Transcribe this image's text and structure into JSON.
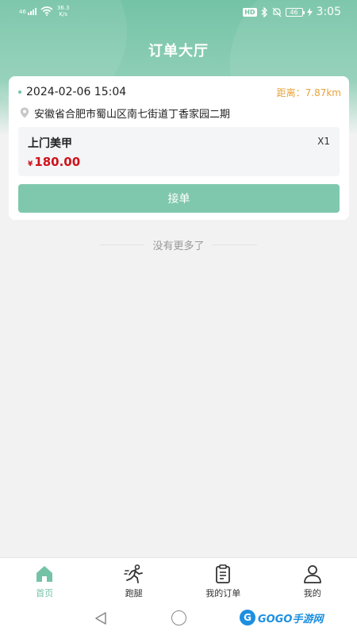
{
  "status_bar": {
    "network_label": "46",
    "speed_value": "36.3",
    "speed_unit": "K/s",
    "hd_label": "HD",
    "battery_label": "46",
    "time": "3:05"
  },
  "header": {
    "title": "订单大厅"
  },
  "order": {
    "datetime": "2024-02-06 15:04",
    "distance": "距离：7.87km",
    "address": "安徽省合肥市蜀山区南七街道丁香家园二期",
    "item_name": "上门美甲",
    "quantity": "X1",
    "currency": "¥",
    "price": "180.00",
    "accept_label": "接单"
  },
  "list_footer": {
    "no_more_text": "没有更多了"
  },
  "tabbar": {
    "items": [
      {
        "label": "首页",
        "icon": "home-icon",
        "active": true
      },
      {
        "label": "跑腿",
        "icon": "runner-icon",
        "active": false
      },
      {
        "label": "我的订单",
        "icon": "clipboard-icon",
        "active": false
      },
      {
        "label": "我的",
        "icon": "user-icon",
        "active": false
      }
    ]
  },
  "watermark": {
    "text": "GOGO手游网"
  },
  "colors": {
    "accent": "#74c3a6",
    "price": "#d0121b",
    "distance": "#e8a23a"
  }
}
